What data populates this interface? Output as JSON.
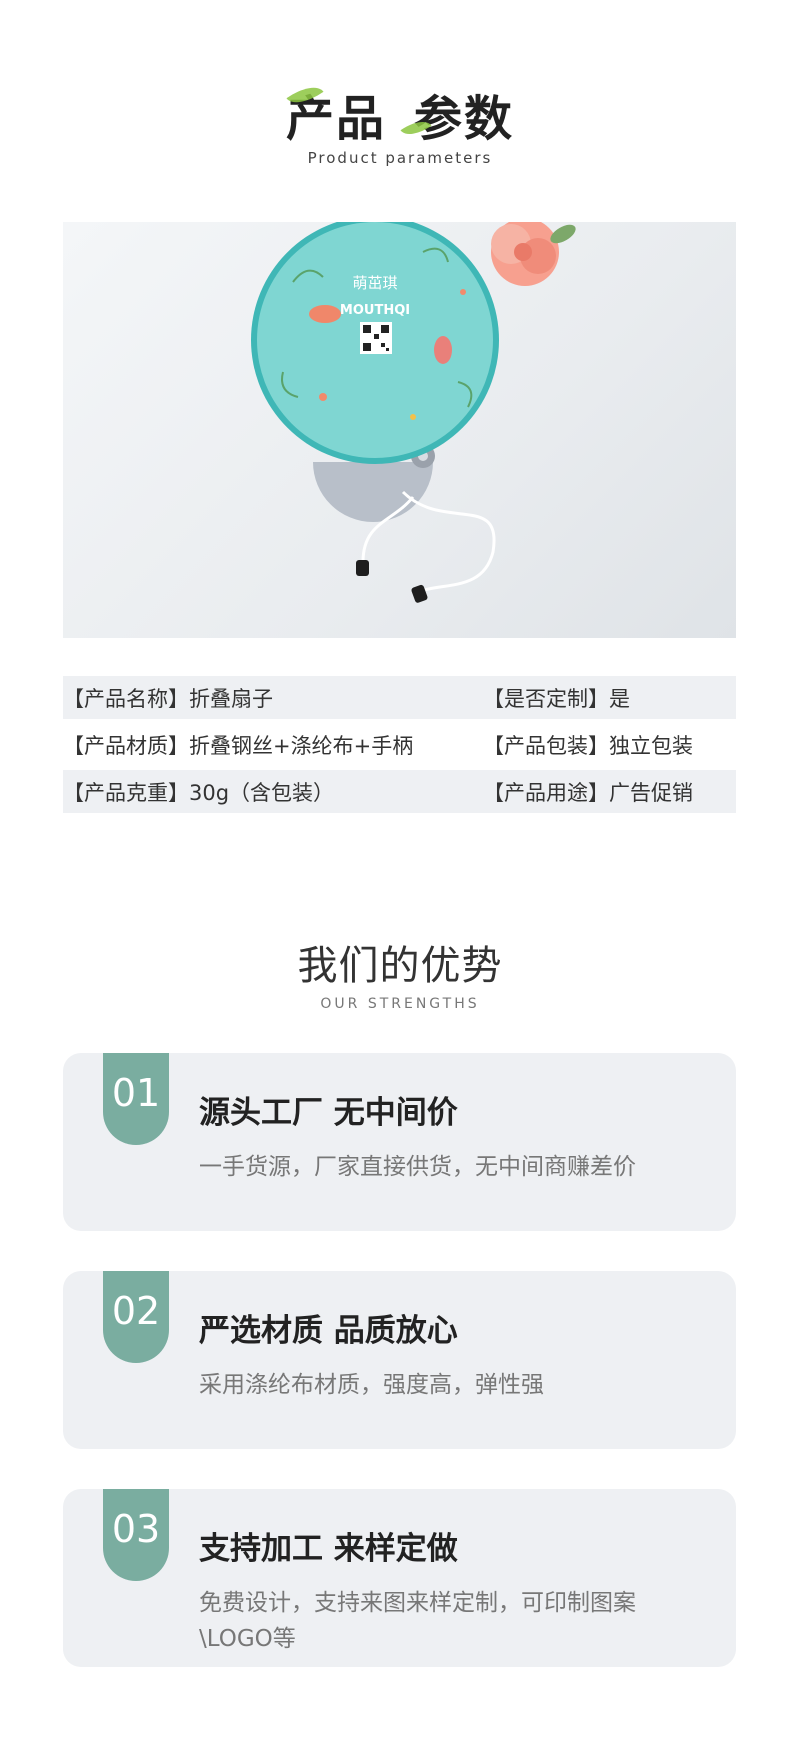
{
  "header": {
    "title_part1": "产品",
    "title_part2": "参数",
    "subtitle": "Product parameters"
  },
  "product_image": {
    "brand_cn": "萌茁琪",
    "brand_en": "MOUTHQI",
    "description": "green round folding fan with birds, QR code and strap"
  },
  "specs": [
    {
      "left": "【产品名称】折叠扇子",
      "right": "【是否定制】是"
    },
    {
      "left": "【产品材质】折叠钢丝+涤纶布+手柄",
      "right": "【产品包装】独立包装"
    },
    {
      "left": "【产品克重】30g（含包装）",
      "right": "【产品用途】广告促销"
    }
  ],
  "strengths": {
    "title": "我们的优势",
    "subtitle": "OUR STRENGTHS",
    "items": [
      {
        "num": "01",
        "title": "源头工厂  无中间价",
        "desc": "一手货源，厂家直接供货，无中间商赚差价"
      },
      {
        "num": "02",
        "title": "严选材质  品质放心",
        "desc": "采用涤纶布材质，强度高，弹性强"
      },
      {
        "num": "03",
        "title": "支持加工  来样定做",
        "desc": "免费设计，支持来图来样定制，可印制图案\\LOGO等"
      }
    ]
  },
  "colors": {
    "accent": "#7aada0",
    "card_bg": "#eef0f3",
    "leaf": "#8cc63f",
    "fan": "#7fd6d2"
  }
}
